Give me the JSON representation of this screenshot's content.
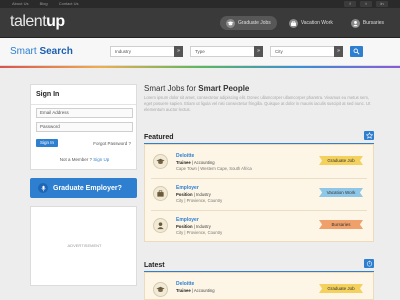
{
  "topbar": {
    "links": [
      "About Us",
      "Blog",
      "Contact Us"
    ],
    "social": [
      "f",
      "t",
      "in"
    ]
  },
  "header": {
    "logo_light": "talent",
    "logo_bold": "up",
    "nav": [
      {
        "label": "Graduate Jobs",
        "active": true,
        "icon": "graduation-cap-icon"
      },
      {
        "label": "Vacation Work",
        "active": false,
        "icon": "briefcase-icon"
      },
      {
        "label": "Bursaries",
        "active": false,
        "icon": "user-icon"
      }
    ]
  },
  "search": {
    "title_light": "Smart ",
    "title_bold": "Search",
    "industry": "Industry",
    "type": "Type",
    "city": "City",
    "arrow": "»"
  },
  "signin": {
    "title": "Sign In",
    "email_placeholder": "Email Address",
    "password_placeholder": "Password",
    "button": "Sign In",
    "forgot": "Forgot Password ?",
    "not_member": "Not a Member ?",
    "signup": "Sign Up"
  },
  "graduate_employer": "Graduate Employer?",
  "advertisement": "ADVERTISEMENT",
  "main": {
    "title_light": "Smart Jobs for ",
    "title_bold": "Smart People",
    "intro": "Lorem ipsum dolor sit amet, consectetur adipiscing elit. Donec ullamcorper ullamcorper pharetra. Vivamus eu metus sem, eget posuere sapien. Etiam ut ligula vel nisi consectetur fringilla. Quisque at dolor in mauris iaculis suscipit at sed nunc. Ut elementum auctor lectus.",
    "featured_title": "Featured",
    "latest_title": "Latest",
    "featured": [
      {
        "title": "Deloitte",
        "sub_bold": "Trainee",
        "sub_rest": " | Accounting",
        "location": "Cape Town | Western Cape, South Africa",
        "badge": "Graduate Job",
        "badge_color": "#f3d15c"
      },
      {
        "title": "Employer",
        "sub_bold": "Position",
        "sub_rest": " | Industry",
        "location": "City | Provience, Country",
        "badge": "Vacation Work",
        "badge_color": "#8fc7e8"
      },
      {
        "title": "Employer",
        "sub_bold": "Position",
        "sub_rest": " | Industry",
        "location": "City | Provience, Country",
        "badge": "Bursaries",
        "badge_color": "#f0a06a"
      }
    ],
    "latest": [
      {
        "title": "Deloitte",
        "sub_bold": "Trainee",
        "sub_rest": " | Accounting",
        "badge": "Graduate Job",
        "badge_color": "#f3d15c"
      }
    ]
  }
}
